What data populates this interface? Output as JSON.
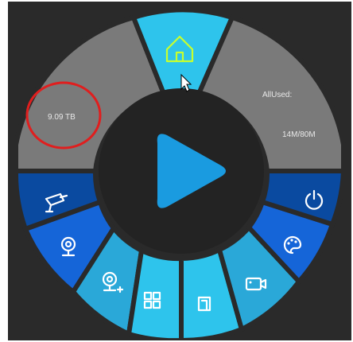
{
  "disk": {
    "total": "9.09 TB",
    "used_label": "AllUsed:",
    "used_value": "14M/80M"
  },
  "menu": {
    "home": "home-icon",
    "play": "play-icon",
    "items_left": [
      "camera-icon",
      "webcam-icon",
      "add-camera-icon",
      "grid-icon"
    ],
    "items_right": [
      "power-icon",
      "palette-icon",
      "video-icon",
      "file-icon"
    ]
  },
  "colors": {
    "background": "#2a2a2a",
    "gray_panel": "#7a7a7a",
    "cyan": "#2ec4ec",
    "teal": "#2aa8d8",
    "blue": "#1565d8",
    "navy": "#0a4aa0",
    "center": "#232323",
    "play": "#1a9be0",
    "highlight_circle": "#e01e1e",
    "home_icon": "#c7ff2e"
  }
}
